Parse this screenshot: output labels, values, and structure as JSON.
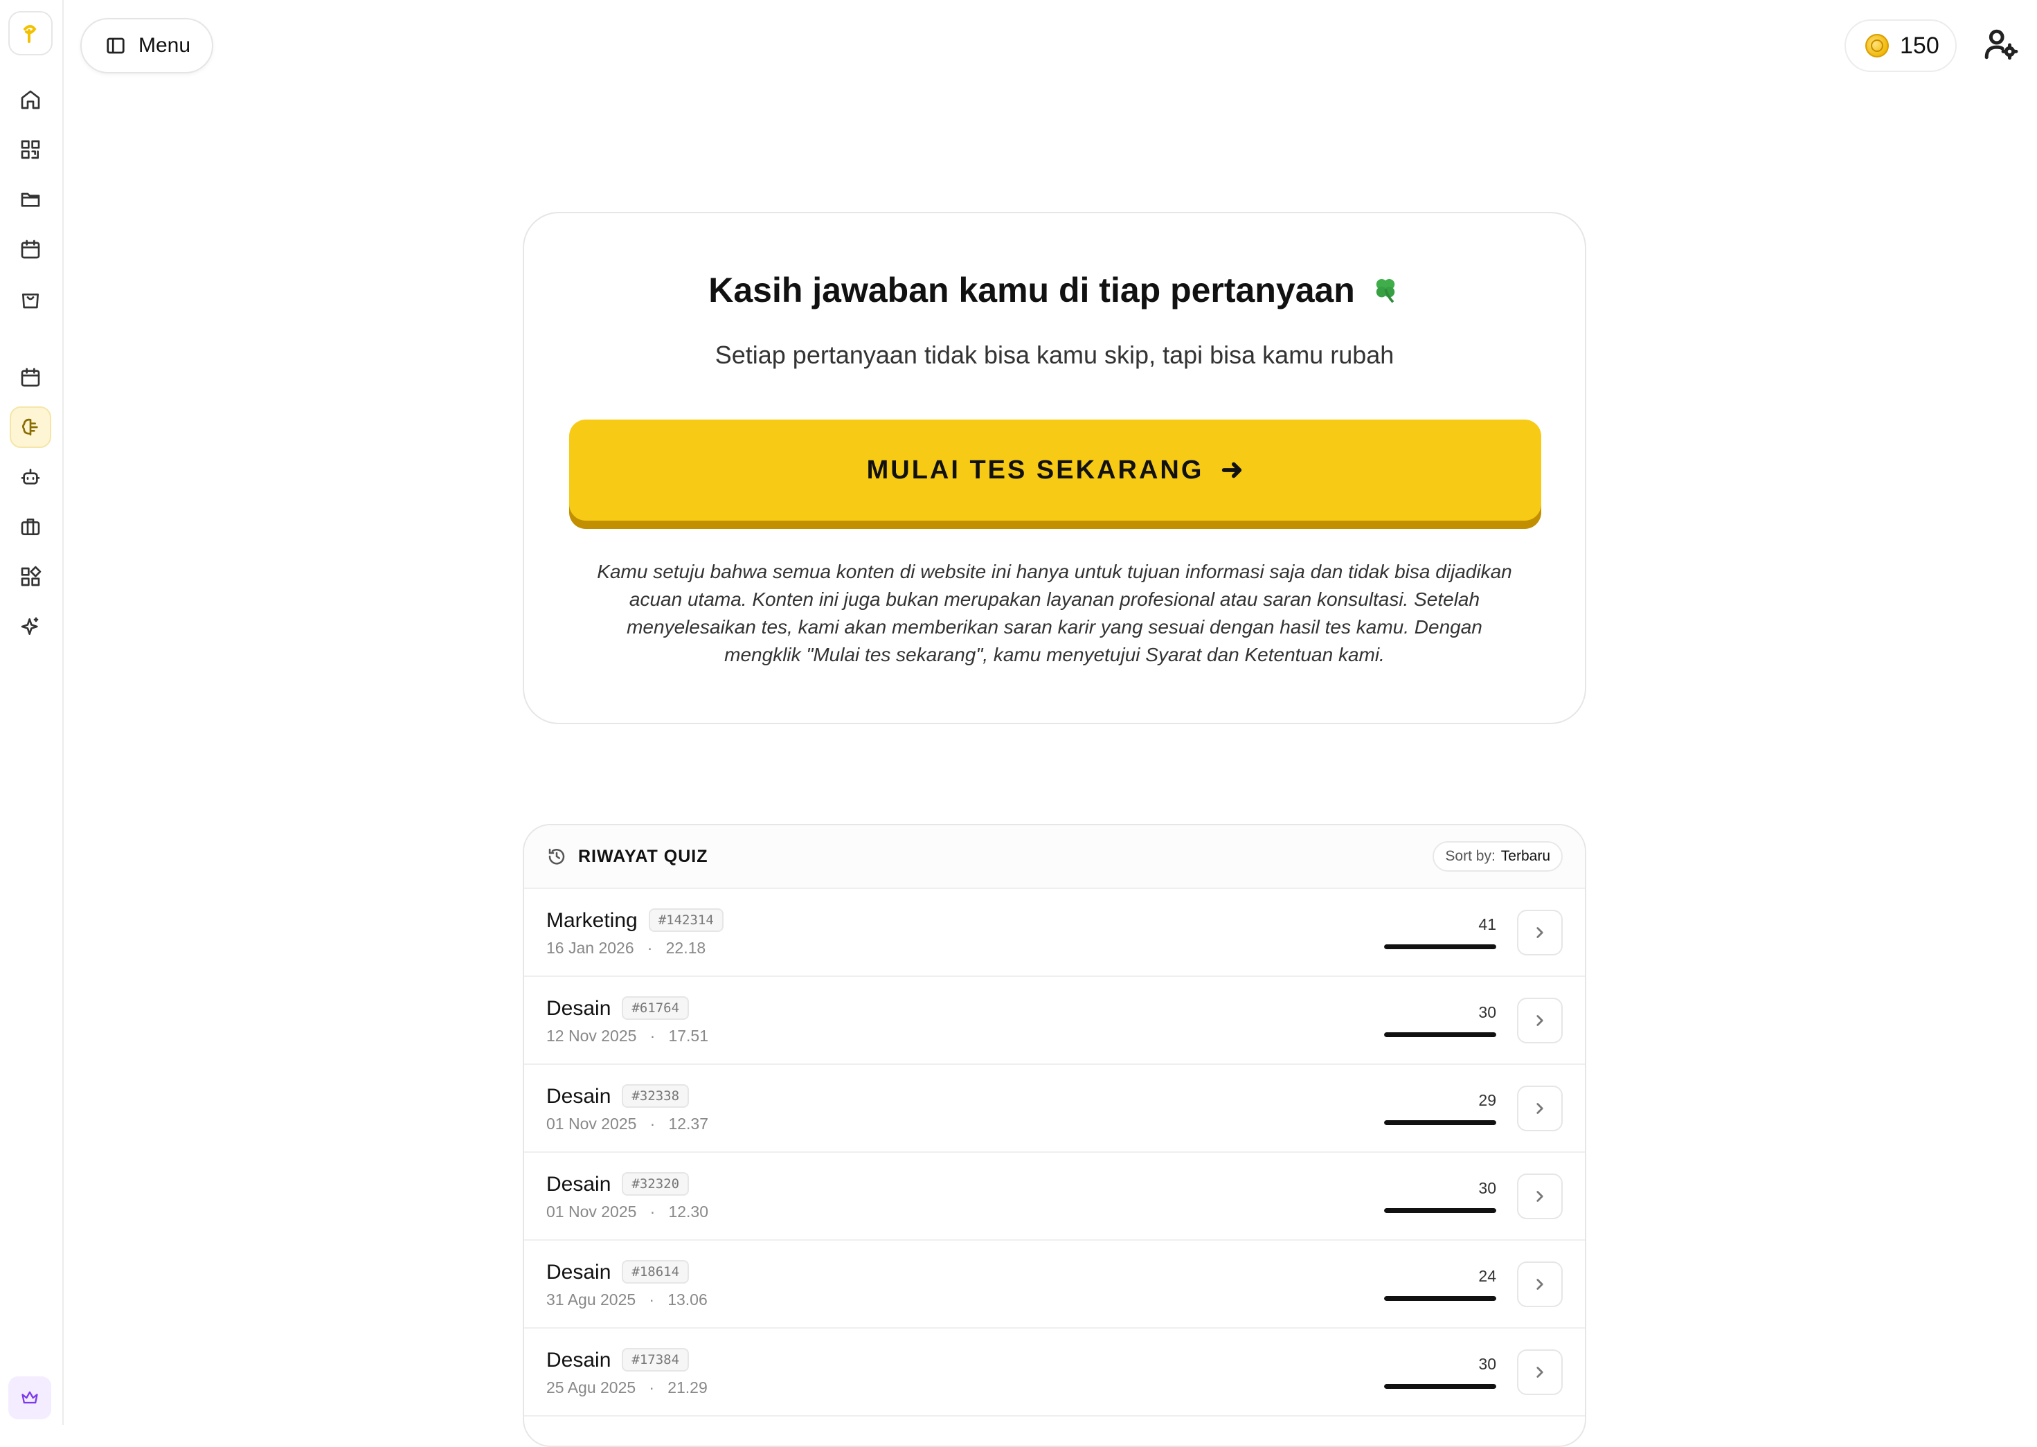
{
  "header": {
    "menu_label": "Menu",
    "coins": "150"
  },
  "hero": {
    "title": "Kasih jawaban kamu di tiap pertanyaan",
    "subtitle": "Setiap pertanyaan tidak bisa kamu skip, tapi bisa kamu rubah",
    "cta_label": "MULAI TES SEKARANG",
    "disclaimer": "Kamu setuju bahwa semua konten di website ini hanya untuk tujuan informasi saja dan tidak bisa dijadikan acuan utama. Konten ini juga bukan merupakan layanan profesional atau saran konsultasi. Setelah menyelesaikan tes, kami akan memberikan saran karir yang sesuai dengan hasil tes kamu. Dengan mengklik \"Mulai tes sekarang\", kamu menyetujui Syarat dan Ketentuan kami."
  },
  "history": {
    "title": "RIWAYAT QUIZ",
    "sort_label": "Sort by:",
    "sort_value": "Terbaru",
    "rows": [
      {
        "name": "Marketing",
        "id": "#142314",
        "date": "16 Jan 2026",
        "time": "22.18",
        "score": "41"
      },
      {
        "name": "Desain",
        "id": "#61764",
        "date": "12 Nov 2025",
        "time": "17.51",
        "score": "30"
      },
      {
        "name": "Desain",
        "id": "#32338",
        "date": "01 Nov 2025",
        "time": "12.37",
        "score": "29"
      },
      {
        "name": "Desain",
        "id": "#32320",
        "date": "01 Nov 2025",
        "time": "12.30",
        "score": "30"
      },
      {
        "name": "Desain",
        "id": "#18614",
        "date": "31 Agu 2025",
        "time": "13.06",
        "score": "24"
      },
      {
        "name": "Desain",
        "id": "#17384",
        "date": "25 Agu 2025",
        "time": "21.29",
        "score": "30"
      }
    ]
  },
  "sidebar": {
    "icons": [
      "home-icon",
      "qr-code-icon",
      "folder-icon",
      "calendar-icon",
      "shopping-bag-icon",
      "calendar-icon",
      "brain-icon",
      "robot-icon",
      "briefcase-icon",
      "apps-icon",
      "sparkles-icon",
      "crown-icon"
    ]
  },
  "colors": {
    "accent": "#f7cb15",
    "accent_shadow": "#c28f00",
    "active_bg": "#fdf5d4"
  }
}
